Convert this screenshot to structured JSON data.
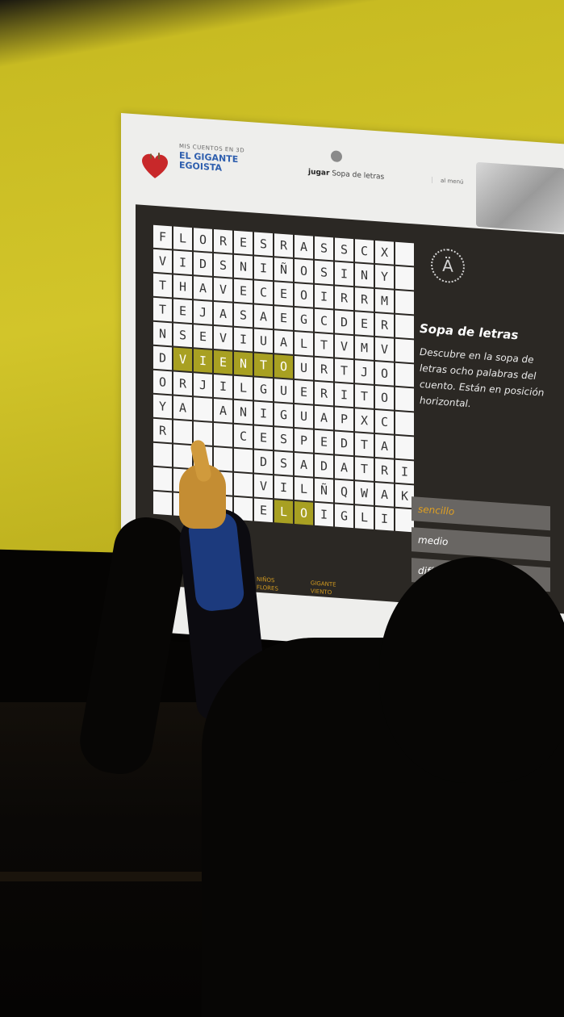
{
  "header": {
    "logo_small": "MIS CUENTOS EN 3D",
    "logo_title_1": "EL GIGANTE",
    "logo_title_2": "EGOISTA",
    "nav_jugar_bold": "jugar",
    "nav_jugar_rest": "Sopa de letras",
    "nav_menu": "al menú"
  },
  "grid": {
    "rows": [
      [
        "F",
        "L",
        "O",
        "R",
        "E",
        "S",
        "R",
        "A",
        "S",
        "S",
        "C",
        "X",
        ""
      ],
      [
        "V",
        "I",
        "D",
        "S",
        "N",
        "I",
        "Ñ",
        "O",
        "S",
        "I",
        "N",
        "Y",
        ""
      ],
      [
        "T",
        "H",
        "A",
        "V",
        "E",
        "C",
        "E",
        "O",
        "I",
        "R",
        "R",
        "M",
        ""
      ],
      [
        "T",
        "E",
        "J",
        "A",
        "S",
        "A",
        "E",
        "G",
        "C",
        "D",
        "E",
        "R",
        ""
      ],
      [
        "N",
        "S",
        "E",
        "V",
        "I",
        "U",
        "A",
        "L",
        "T",
        "V",
        "M",
        "V",
        ""
      ],
      [
        "D",
        "V",
        "I",
        "E",
        "N",
        "T",
        "O",
        "U",
        "R",
        "T",
        "J",
        "O",
        ""
      ],
      [
        "O",
        "R",
        "J",
        "I",
        "L",
        "G",
        "U",
        "E",
        "R",
        "I",
        "T",
        "O",
        ""
      ],
      [
        "Y",
        "A",
        "",
        "A",
        "N",
        "I",
        "G",
        "U",
        "A",
        "P",
        "X",
        "C",
        ""
      ],
      [
        "R",
        "",
        "",
        "",
        "C",
        "E",
        "S",
        "P",
        "E",
        "D",
        "T",
        "A",
        ""
      ],
      [
        "",
        "",
        "",
        "",
        "",
        "D",
        "S",
        "A",
        "D",
        "A",
        "T",
        "R",
        "I"
      ],
      [
        "",
        "",
        "",
        "",
        "",
        "V",
        "I",
        "L",
        "Ñ",
        "Q",
        "W",
        "A",
        "K"
      ],
      [
        "",
        "",
        "",
        "",
        "",
        "E",
        "L",
        "O",
        "I",
        "G",
        "L",
        "I",
        ""
      ]
    ],
    "highlight_word": "VIENTO"
  },
  "side": {
    "title": "Sopa de letras",
    "description": "Descubre en la sopa de letras ocho palabras del cuento. Están en posición horizontal.",
    "levels": [
      "sencillo",
      "medio",
      "difícil"
    ],
    "active_level": "sencillo"
  },
  "legend": {
    "col1": [
      "NIÑOS",
      "FLORES"
    ],
    "col2": [
      "GIGANTE",
      "VIENTO"
    ]
  },
  "colors": {
    "wall": "#d2c52a",
    "panel": "#2b2824",
    "highlight": "#a8a022",
    "active_level": "#e0a022"
  }
}
